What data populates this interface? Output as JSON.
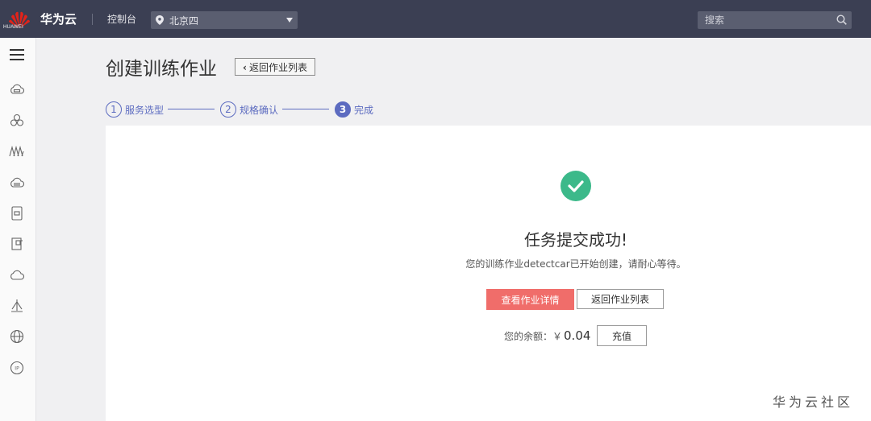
{
  "topbar": {
    "logo_text": "HUAWEI",
    "brand": "华为云",
    "console_label": "控制台",
    "region": "北京四",
    "search_placeholder": "搜索"
  },
  "sidebar": {
    "icons": [
      "cloud-server-icon",
      "cloud-cluster-icon",
      "network-icon",
      "cloud-storage-icon",
      "database-icon",
      "container-icon",
      "cloud-icon",
      "security-icon",
      "globe-icon",
      "ip-icon"
    ]
  },
  "page": {
    "title": "创建训练作业",
    "back_button": "返回作业列表"
  },
  "steps": [
    {
      "num": "1",
      "label": "服务选型",
      "active": false
    },
    {
      "num": "2",
      "label": "规格确认",
      "active": false
    },
    {
      "num": "3",
      "label": "完成",
      "active": true
    }
  ],
  "result": {
    "title": "任务提交成功!",
    "message": "您的训练作业detectcar已开始创建，请耐心等待。",
    "primary_button": "查看作业详情",
    "secondary_button": "返回作业列表",
    "balance_label": "您的余额：￥",
    "balance_amount": "0.04",
    "recharge_button": "充值"
  },
  "watermark": "华为云社区",
  "colors": {
    "topbar": "#3b3f53",
    "accent": "#5c6bc0",
    "success": "#3cb98a",
    "primary_button": "#f06d6a"
  }
}
